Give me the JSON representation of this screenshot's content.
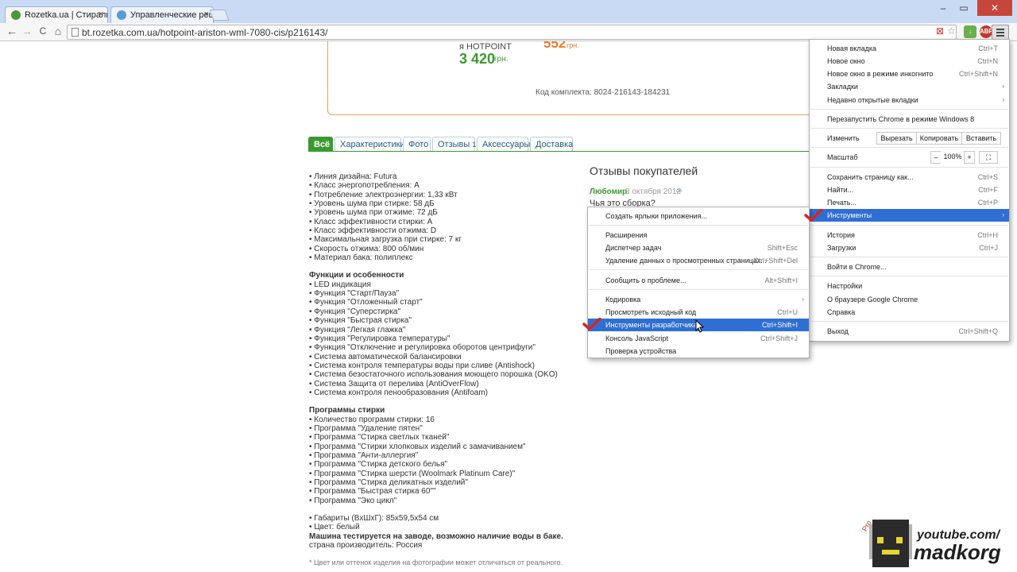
{
  "browser": {
    "tabs": [
      {
        "title": "Rozetka.ua | Стиральная",
        "close": "×"
      },
      {
        "title": "Управленческие решени",
        "close": "×"
      }
    ],
    "window_controls": {
      "minimize": "–",
      "maximize": "▭",
      "close": "✕"
    },
    "nav": {
      "back": "←",
      "forward": "→",
      "reload": "C",
      "home": "⌂"
    },
    "address": "bt.rozetka.com.ua/hotpoint-ariston-wml-7080-cis/p216143/",
    "ext_adblock": "ABP"
  },
  "page": {
    "kit": {
      "name": "я HOTPOINT",
      "price": "3 420",
      "currency": "грн.",
      "price2": "552",
      "currency2": "грн.",
      "code": "Код комплекта: 8024-216143-184231"
    },
    "tabs": [
      "Всё",
      "Характеристики",
      "Фото",
      "Отзывы",
      "1",
      "Аксессуары",
      "Доставка"
    ],
    "specs_group1": [
      "• Линия дизайна: Futura",
      "• Класс энергопотребления: A",
      "• Потребление электроэнергии: 1,33 кВт",
      "• Уровень шума при стирке: 58 дБ",
      "• Уровень шума при отжиме: 72 дБ",
      "• Класс эффективности стирки: A",
      "• Класс эффективности отжима: D",
      "• Максимальная загрузка при стирке: 7 кг",
      "• Скорость отжима: 800 об/мин",
      "• Материал бака: полиплекс"
    ],
    "features_title": "Функции и особенности",
    "features": [
      "• LED индикация",
      "• Функция \"Старт/Пауза\"",
      "• Функция \"Отложенный старт\"",
      "• Функция \"Суперстирка\"",
      "• Функция \"Быстрая стирка\"",
      "• Функция \"Легкая глажка\"",
      "• Функция \"Регулировка температуры\"",
      "• Функция \"Отключение и регулировка оборотов центрифуги\"",
      "• Система автоматической балансировки",
      "• Система контроля температуры воды при сливе (Antishock)",
      "• Система безостаточного использования моющего порошка (OKO)",
      "• Система Защита от перелива (AntiOverFlow)",
      "• Система контроля пенообразования (Antifoam)"
    ],
    "programs_title": "Программы стирки",
    "programs": [
      "• Количество программ стирки: 16",
      "• Программа \"Удаление пятен\"",
      "• Программа \"Стирка светлых тканей\"",
      "• Программа \"Стирки хлопковых изделий с замачиванием\"",
      "• Программа \"Анти-аллергия\"",
      "• Программа \"Стирка детского белья\"",
      "• Программа \"Стирка шерсти (Woolmark Platinum Care)\"",
      "• Программа \"Стирка деликатных изделий\"",
      "• Программа \"Быстрая стирка 60\"\"",
      "• Программа \"Эко цикл\""
    ],
    "dims": "• Габариты (ВхШхГ): 85x59,5x54 см",
    "color": "• Цвет: белый",
    "tested": "Машина тестируется на заводе, возможно наличие воды в баке.",
    "country": "страна производитель:  Россия",
    "note": "* Цвет или оттенок изделия на фотографии может отличаться от реального.",
    "reviews": {
      "title": "Отзывы покупателей",
      "author": "Любомир",
      "date": "3 октября 2012",
      "link": "∞",
      "text": "Чья это сборка?"
    }
  },
  "chrome_menu": {
    "items": [
      {
        "label": "Новая вкладка",
        "shortcut": "Ctrl+T"
      },
      {
        "label": "Новое окно",
        "shortcut": "Ctrl+N"
      },
      {
        "label": "Новое окно в режиме инкогнито",
        "shortcut": "Ctrl+Shift+N"
      },
      {
        "label": "Закладки",
        "shortcut": ""
      },
      {
        "label": "Недавно открытые вкладки",
        "shortcut": ""
      },
      {
        "label": "Перезапустить Chrome в режиме Windows 8",
        "shortcut": ""
      },
      {
        "label": "Изменить",
        "shortcut": ""
      },
      {
        "label": "Масштаб",
        "shortcut": ""
      },
      {
        "label": "Сохранить страницу как...",
        "shortcut": "Ctrl+S"
      },
      {
        "label": "Найти...",
        "shortcut": "Ctrl+F"
      },
      {
        "label": "Печать...",
        "shortcut": "Ctrl+P"
      },
      {
        "label": "Инструменты",
        "shortcut": ""
      },
      {
        "label": "История",
        "shortcut": "Ctrl+H"
      },
      {
        "label": "Загрузки",
        "shortcut": "Ctrl+J"
      },
      {
        "label": "Войти в Chrome...",
        "shortcut": ""
      },
      {
        "label": "Настройки",
        "shortcut": ""
      },
      {
        "label": "О браузере Google Chrome",
        "shortcut": ""
      },
      {
        "label": "Справка",
        "shortcut": ""
      },
      {
        "label": "Выход",
        "shortcut": "Ctrl+Shift+Q"
      }
    ],
    "submenu_arrow": "›",
    "edit_buttons": [
      "Вырезать",
      "Копировать",
      "Вставить"
    ],
    "zoom": {
      "minus": "–",
      "value": "100%",
      "plus": "+",
      "fullscreen": "⛶"
    }
  },
  "tools_menu": {
    "items": [
      {
        "label": "Создать ярлыки приложения...",
        "shortcut": ""
      },
      {
        "label": "Расширения",
        "shortcut": ""
      },
      {
        "label": "Диспетчер задач",
        "shortcut": "Shift+Esc"
      },
      {
        "label": "Удаление данных о просмотренных страницах...",
        "shortcut": "Ctrl+Shift+Del"
      },
      {
        "label": "Сообщить о проблеме...",
        "shortcut": "Alt+Shift+I"
      },
      {
        "label": "Кодировка",
        "shortcut": ""
      },
      {
        "label": "Просмотреть исходный код",
        "shortcut": "Ctrl+U"
      },
      {
        "label": "Инструменты разработчика",
        "shortcut": "Ctrl+Shift+I"
      },
      {
        "label": "Консоль JavaScript",
        "shortcut": "Ctrl+Shift+J"
      },
      {
        "label": "Проверка устройства",
        "shortcut": ""
      }
    ]
  },
  "watermark": {
    "line1": "youtube.com/",
    "line2": "madkorg"
  },
  "colors": {
    "accent_green": "#3a9a2f",
    "menu_highlight": "#2f6fd4",
    "check_red": "#d9261c",
    "price_orange": "#e77c2a"
  }
}
